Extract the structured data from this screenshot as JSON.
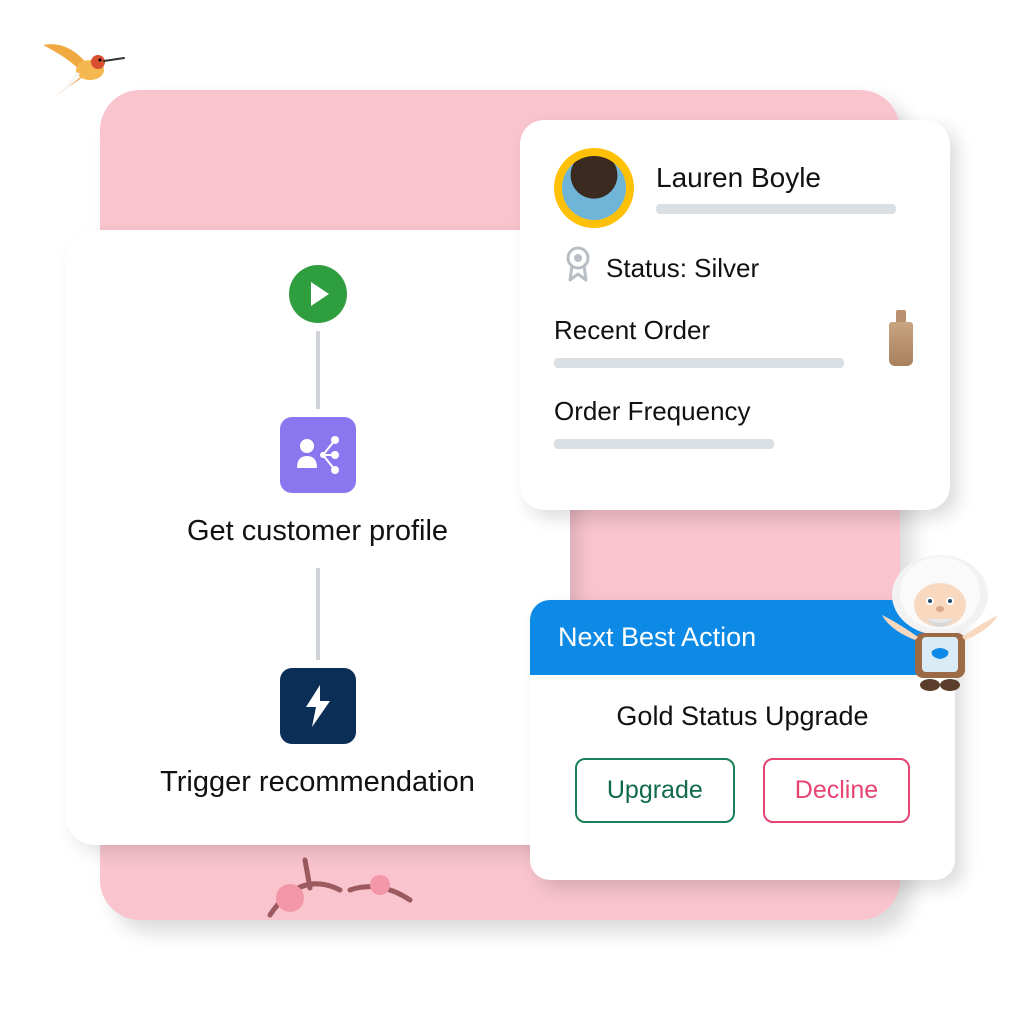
{
  "flow": {
    "step1_label": "Get customer profile",
    "step2_label": "Trigger recommendation"
  },
  "profile": {
    "name": "Lauren Boyle",
    "status_prefix": "Status: ",
    "status_value": "Silver",
    "recent_order_label": "Recent Order",
    "order_frequency_label": "Order Frequency"
  },
  "action": {
    "header": "Next Best Action",
    "title": "Gold Status Upgrade",
    "upgrade_label": "Upgrade",
    "decline_label": "Decline"
  }
}
